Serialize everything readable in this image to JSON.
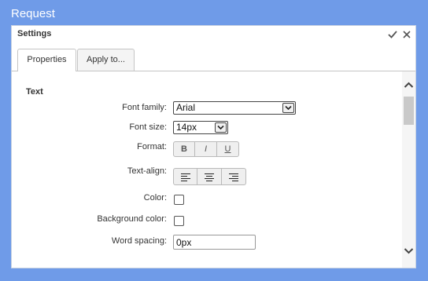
{
  "app": {
    "title": "Request"
  },
  "dialog": {
    "title": "Settings",
    "tabs": [
      {
        "label": "Properties"
      },
      {
        "label": "Apply to..."
      }
    ],
    "section": "Text",
    "fields": {
      "font_family": {
        "label": "Font family:",
        "value": "Arial"
      },
      "font_size": {
        "label": "Font size:",
        "value": "14px"
      },
      "format": {
        "label": "Format:",
        "bold": "B",
        "italic": "I",
        "underline": "U"
      },
      "text_align": {
        "label": "Text-align:"
      },
      "color": {
        "label": "Color:"
      },
      "background_color": {
        "label": "Background color:"
      },
      "word_spacing": {
        "label": "Word spacing:",
        "value": "0px"
      }
    }
  },
  "colors": {
    "background": "#6f9be8",
    "dialog": "#ffffff"
  }
}
